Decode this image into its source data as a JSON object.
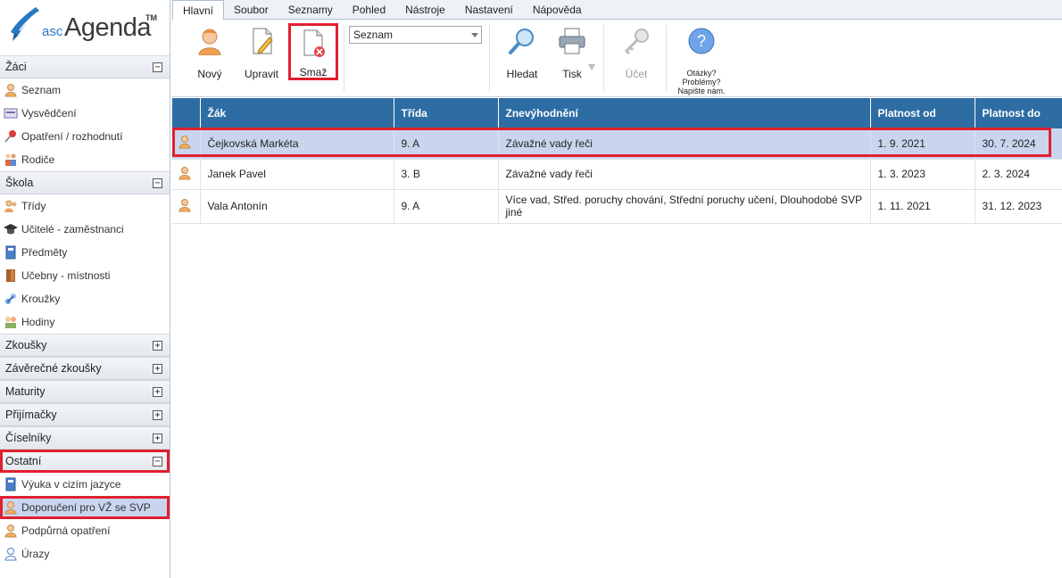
{
  "app": {
    "logo_prefix": "asc",
    "logo_name": "Agenda",
    "logo_tm": "TM"
  },
  "tabs": [
    "Hlavní",
    "Soubor",
    "Seznamy",
    "Pohled",
    "Nástroje",
    "Nastavení",
    "Nápověda"
  ],
  "ribbon": {
    "new_label": "Nový",
    "edit_label": "Upravit",
    "delete_label": "Smaž",
    "view_select": "Seznam",
    "search_label": "Hledat",
    "print_label": "Tisk",
    "account_label": "Účet",
    "help_line1": "Otázky?",
    "help_line2": "Problémy?",
    "help_line3": "Napište nám."
  },
  "sidebar": {
    "sections": [
      {
        "title": "Žáci",
        "toggle": "−",
        "items": [
          "Seznam",
          "Vysvědčení",
          "Opatření / rozhodnutí",
          "Rodiče"
        ]
      },
      {
        "title": "Škola",
        "toggle": "−",
        "items": [
          "Třídy",
          "Učitelé - zaměstnanci",
          "Předměty",
          "Učebny - místnosti",
          "Kroužky",
          "Hodiny"
        ]
      },
      {
        "title": "Zkoušky",
        "toggle": "+"
      },
      {
        "title": "Závěrečné zkoušky",
        "toggle": "+"
      },
      {
        "title": "Maturity",
        "toggle": "+"
      },
      {
        "title": "Přijímačky",
        "toggle": "+"
      },
      {
        "title": "Číselníky",
        "toggle": "+"
      },
      {
        "title": "Ostatní",
        "toggle": "−",
        "items": [
          "Výuka v cizím jazyce",
          "Doporučení pro VŽ se SVP",
          "Podpůrná opatření",
          "Úrazy"
        ]
      }
    ]
  },
  "table": {
    "headers": [
      "",
      "Žák",
      "Třída",
      "Znevýhodnění",
      "Platnost od",
      "Platnost do"
    ],
    "rows": [
      {
        "name": "Čejkovská Markéta",
        "class": "9. A",
        "disadvantage": "Závažné vady řeči",
        "from": "1. 9. 2021",
        "to": "30. 7. 2024"
      },
      {
        "name": "Janek Pavel",
        "class": "3. B",
        "disadvantage": "Závažné vady řeči",
        "from": "1. 3. 2023",
        "to": "2. 3. 2024"
      },
      {
        "name": "Vala Antonín",
        "class": "9. A",
        "disadvantage": "Více vad, Střed. poruchy chování, Střední poruchy učení, Dlouhodobé SVP",
        "disadvantage2": "jiné",
        "from": "1. 11. 2021",
        "to": "31. 12. 2023"
      }
    ]
  },
  "colors": {
    "header_bg": "#2e6da4",
    "selection": "#c9d5ef",
    "highlight": "#e0202e"
  }
}
